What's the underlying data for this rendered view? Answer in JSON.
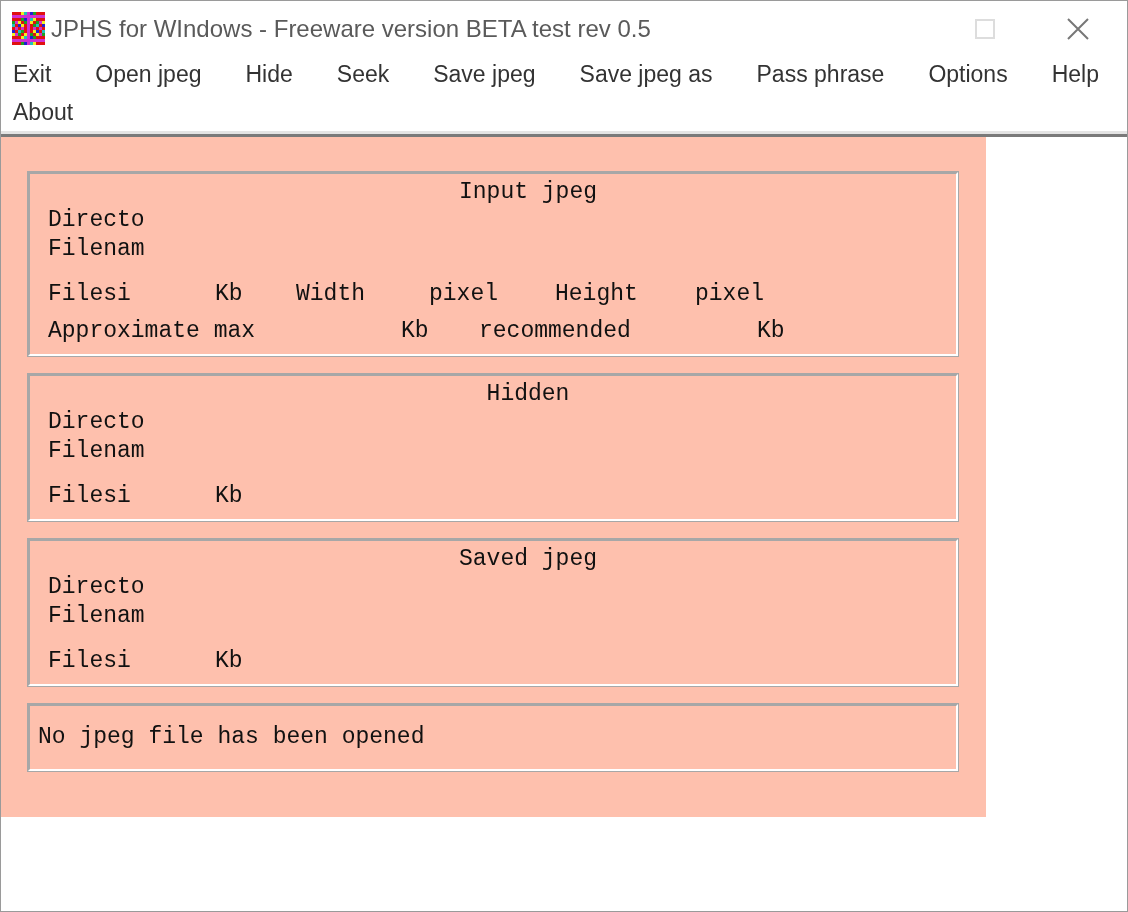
{
  "window": {
    "title": "JPHS for WIndows - Freeware version BETA test rev 0.5"
  },
  "menu": [
    "Exit",
    "Open jpeg",
    "Hide",
    "Seek",
    "Save jpeg",
    "Save jpeg as",
    "Pass phrase",
    "Options",
    "Help",
    "About"
  ],
  "groups": [
    {
      "title": "Input jpeg",
      "lines": [
        [
          "Directo"
        ],
        [
          "Filenam"
        ],
        [
          "Filesi",
          "Kb",
          "Width",
          "pixel",
          "Height",
          "pixel"
        ],
        [
          "Approximate max",
          "Kb",
          "recommended",
          "Kb"
        ]
      ]
    },
    {
      "title": "Hidden",
      "lines": [
        [
          "Directo"
        ],
        [
          "Filenam"
        ],
        [
          "Filesi",
          "Kb"
        ]
      ]
    },
    {
      "title": "Saved jpeg",
      "lines": [
        [
          "Directo"
        ],
        [
          "Filenam"
        ],
        [
          "Filesi",
          "Kb"
        ]
      ]
    }
  ],
  "status": "No jpeg file has been opened"
}
